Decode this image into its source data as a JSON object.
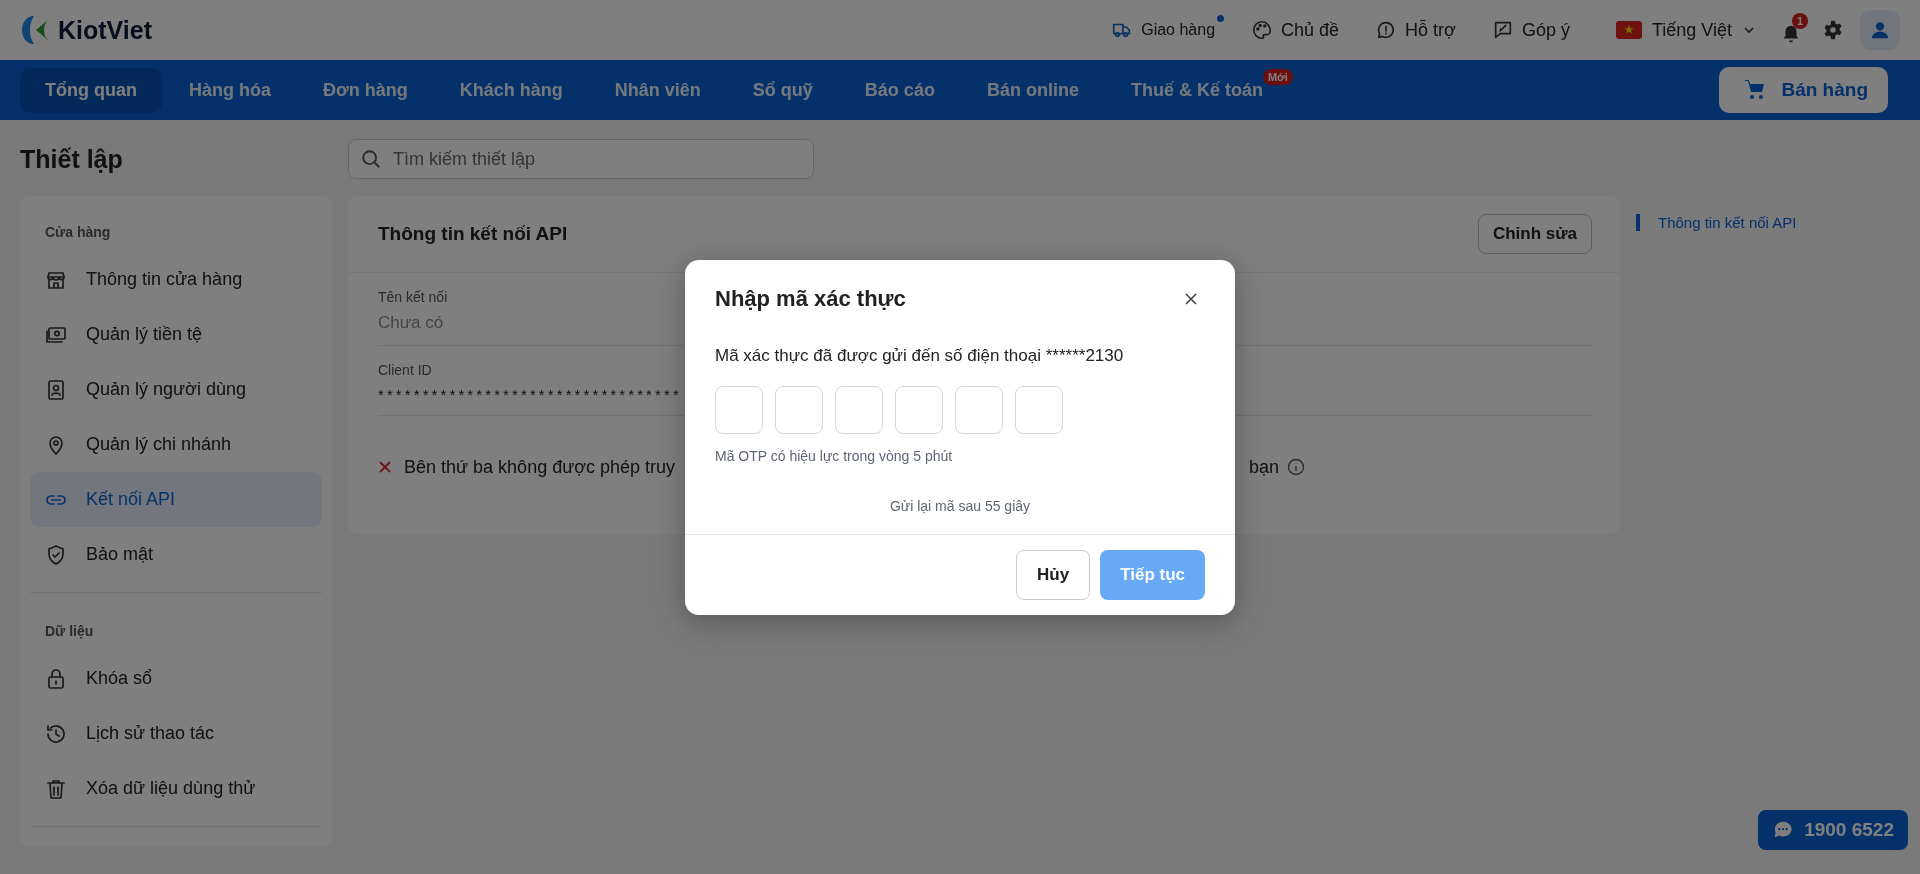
{
  "header": {
    "logo": "KiotViet",
    "actions": [
      {
        "label": "Giao hàng",
        "dot": true
      },
      {
        "label": "Chủ đề",
        "dot": false
      },
      {
        "label": "Hỗ trợ",
        "dot": false
      },
      {
        "label": "Góp ý",
        "dot": false
      }
    ],
    "language": "Tiếng Việt",
    "notifications": "1"
  },
  "nav": {
    "items": [
      {
        "label": "Tổng quan",
        "selected": true
      },
      {
        "label": "Hàng hóa",
        "selected": false
      },
      {
        "label": "Đơn hàng",
        "selected": false
      },
      {
        "label": "Khách hàng",
        "selected": false
      },
      {
        "label": "Nhân viên",
        "selected": false
      },
      {
        "label": "Sổ quỹ",
        "selected": false
      },
      {
        "label": "Báo cáo",
        "selected": false
      },
      {
        "label": "Bán online",
        "selected": false
      },
      {
        "label": "Thuế & Kế toán",
        "selected": false,
        "badge": "Mới"
      }
    ],
    "sell_button": "Bán hàng"
  },
  "page": {
    "title": "Thiết lập",
    "search": {
      "placeholder": "Tìm kiếm thiết lập"
    }
  },
  "sidebar": {
    "sections": [
      {
        "title": "Cửa hàng",
        "items": [
          {
            "label": "Thông tin cửa hàng",
            "selected": false
          },
          {
            "label": "Quản lý tiền tệ",
            "selected": false
          },
          {
            "label": "Quản lý người dùng",
            "selected": false
          },
          {
            "label": "Quản lý chi nhánh",
            "selected": false
          },
          {
            "label": "Kết nối API",
            "selected": true
          },
          {
            "label": "Bảo mật",
            "selected": false
          }
        ]
      },
      {
        "title": "Dữ liệu",
        "items": [
          {
            "label": "Khóa sổ",
            "selected": false
          },
          {
            "label": "Lịch sử thao tác",
            "selected": false
          },
          {
            "label": "Xóa dữ liệu dùng thử",
            "selected": false
          }
        ]
      }
    ]
  },
  "card": {
    "title": "Thông tin kết nối API",
    "edit_button": "Chỉnh sửa",
    "fields": [
      {
        "label": "Tên kết nối",
        "value": "Chưa có",
        "empty": true
      },
      {
        "label": "Client ID",
        "value": "**********************************",
        "empty": false
      }
    ],
    "notice": {
      "text": "Bên thứ ba không được phép truy",
      "tail": "bạn"
    }
  },
  "anchors": [
    {
      "label": "Thông tin kết nối API",
      "selected": true
    }
  ],
  "hotline": "1900 6522",
  "modal": {
    "title": "Nhập mã xác thực",
    "message": "Mã xác thực đã được gửi đến số điện thoại ******2130",
    "otp_fields": [
      {
        "filled": false
      },
      {
        "filled": false
      },
      {
        "filled": false
      },
      {
        "filled": false
      },
      {
        "filled": false
      },
      {
        "filled": false
      }
    ],
    "hint": "Mã OTP có hiệu lực trong vòng 5 phút",
    "resend": "Gửi lại mã sau 55 giây",
    "cancel_button": "Hủy",
    "continue_button": {
      "label": "Tiếp tục",
      "disabled": true
    }
  }
}
